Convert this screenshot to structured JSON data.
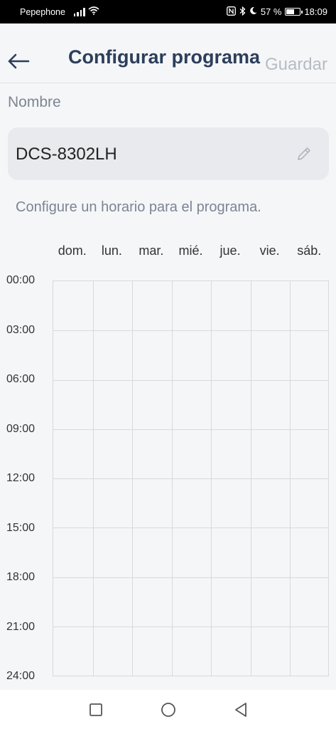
{
  "status_bar": {
    "carrier": "Pepephone",
    "battery": "57 %",
    "battery_level": 0.57,
    "time": "18:09"
  },
  "header": {
    "title": "Configurar programa",
    "save_label": "Guardar"
  },
  "form": {
    "name_label": "Nombre",
    "name_value": "DCS-8302LH",
    "hint": "Configure un horario para el programa."
  },
  "schedule": {
    "days": [
      "dom.",
      "lun.",
      "mar.",
      "mié.",
      "jue.",
      "vie.",
      "sáb."
    ],
    "times": [
      "00:00",
      "03:00",
      "06:00",
      "09:00",
      "12:00",
      "15:00",
      "18:00",
      "21:00",
      "24:00"
    ]
  },
  "colors": {
    "title": "#2c3e5a",
    "save_disabled": "#b7bcc4",
    "muted_text": "#7c8593",
    "field_bg": "#e8eaed",
    "grid_line": "#d6d9de"
  },
  "icons": {
    "back": "arrow-left-icon",
    "edit": "pencil-icon",
    "nav_recent": "square-icon",
    "nav_home": "circle-icon",
    "nav_back": "triangle-back-icon"
  }
}
